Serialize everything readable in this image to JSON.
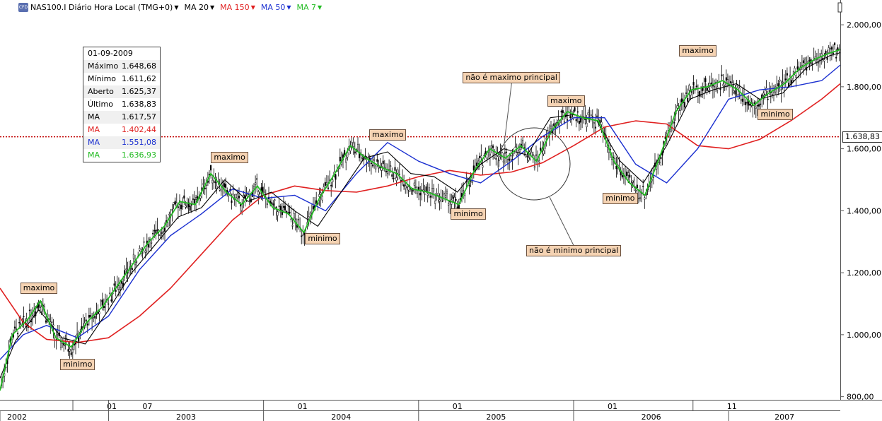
{
  "header": {
    "logo_text": "CFD",
    "symbol": "NAS100.I Diário Hora Local (TMG+0)",
    "indicators": [
      {
        "label": "MA 20",
        "color": "#000000"
      },
      {
        "label": "MA 150",
        "color": "#e02020"
      },
      {
        "label": "MA 50",
        "color": "#1a2fd0"
      },
      {
        "label": "MA 7",
        "color": "#22bb22"
      }
    ]
  },
  "infobox": {
    "date": "01-09-2009",
    "rows": [
      {
        "label": "Máximo",
        "value": "1.648,68",
        "color": "#000000"
      },
      {
        "label": "Mínimo",
        "value": "1.611,62",
        "color": "#000000"
      },
      {
        "label": "Aberto",
        "value": "1.625,37",
        "color": "#000000"
      },
      {
        "label": "Último",
        "value": "1.638,83",
        "color": "#000000"
      },
      {
        "label": "MA",
        "value": "1.617,57",
        "color": "#000000"
      },
      {
        "label": "MA",
        "value": "1.402,44",
        "color": "#e02020"
      },
      {
        "label": "MA",
        "value": "1.551,08",
        "color": "#1a2fd0"
      },
      {
        "label": "MA",
        "value": "1.636,93",
        "color": "#22bb22"
      }
    ]
  },
  "current_price_label": "1.638,83",
  "annotations": [
    {
      "text": "maximo",
      "x": 2002.55,
      "y": 1150,
      "kind": "max"
    },
    {
      "text": "minimo",
      "x": 2002.8,
      "y": 905,
      "kind": "min"
    },
    {
      "text": "maximo",
      "x": 2003.78,
      "y": 1572,
      "kind": "max"
    },
    {
      "text": "minimo",
      "x": 2004.38,
      "y": 1310,
      "kind": "min"
    },
    {
      "text": "maximo",
      "x": 2004.8,
      "y": 1645,
      "kind": "max"
    },
    {
      "text": "minimo",
      "x": 2005.32,
      "y": 1390,
      "kind": "min"
    },
    {
      "text": "maximo",
      "x": 2005.95,
      "y": 1755,
      "kind": "max"
    },
    {
      "text": "minimo",
      "x": 2006.3,
      "y": 1440,
      "kind": "min"
    },
    {
      "text": "maximo",
      "x": 2006.8,
      "y": 1915,
      "kind": "max"
    },
    {
      "text": "minimo",
      "x": 2007.3,
      "y": 1710,
      "kind": "min"
    },
    {
      "text": "não é maximo principal",
      "x": 2005.6,
      "y": 1830,
      "kind": "note"
    },
    {
      "text": "não é minimo principal",
      "x": 2006.0,
      "y": 1270,
      "kind": "note"
    }
  ],
  "chart_data": {
    "type": "line",
    "title": "NAS100.I Diário Hora Local (TMG+0)",
    "xlabel": "",
    "ylabel": "",
    "xlim": [
      2002.3,
      2007.72
    ],
    "ylim": [
      790,
      2080
    ],
    "grid": false,
    "legend": "top-left",
    "current_price": 1638.83,
    "y_ticks": [
      {
        "value": 800,
        "label": "800,00"
      },
      {
        "value": 1000,
        "label": "1.000,00"
      },
      {
        "value": 1200,
        "label": "1.200,00"
      },
      {
        "value": 1400,
        "label": "1.400,00"
      },
      {
        "value": 1600,
        "label": "1.600,00"
      },
      {
        "value": 1800,
        "label": "1.800,00"
      },
      {
        "value": 2000,
        "label": "2.000,00"
      }
    ],
    "x_ticks_upper": [
      {
        "x": 2002.77,
        "label": "01"
      },
      {
        "x": 2003.0,
        "label": "07"
      },
      {
        "x": 2004.0,
        "label": "01"
      },
      {
        "x": 2005.0,
        "label": "01"
      },
      {
        "x": 2006.0,
        "label": "01"
      },
      {
        "x": 2006.77,
        "label": "11"
      }
    ],
    "x_ticks_lower": [
      {
        "x": 2002.3,
        "label": "2002"
      },
      {
        "x": 2003.0,
        "label": "2003"
      },
      {
        "x": 2004.0,
        "label": "2004"
      },
      {
        "x": 2005.0,
        "label": "2005"
      },
      {
        "x": 2006.0,
        "label": "2006"
      },
      {
        "x": 2007.0,
        "label": "2007"
      }
    ],
    "series": [
      {
        "name": "MA 150",
        "color": "#e02020",
        "x": [
          2002.3,
          2002.45,
          2002.6,
          2002.8,
          2003.0,
          2003.2,
          2003.4,
          2003.6,
          2003.8,
          2004.0,
          2004.2,
          2004.4,
          2004.6,
          2004.8,
          2005.0,
          2005.2,
          2005.4,
          2005.6,
          2005.8,
          2006.0,
          2006.2,
          2006.4,
          2006.6,
          2006.8,
          2007.0,
          2007.2,
          2007.4,
          2007.6,
          2007.72
        ],
        "values": [
          1150,
          1040,
          985,
          975,
          990,
          1060,
          1150,
          1260,
          1370,
          1450,
          1480,
          1465,
          1460,
          1480,
          1510,
          1530,
          1515,
          1525,
          1555,
          1610,
          1670,
          1690,
          1680,
          1610,
          1600,
          1630,
          1690,
          1760,
          1810
        ]
      },
      {
        "name": "MA 50",
        "color": "#1a2fd0",
        "x": [
          2002.3,
          2002.45,
          2002.6,
          2002.8,
          2003.0,
          2003.2,
          2003.4,
          2003.6,
          2003.8,
          2004.0,
          2004.2,
          2004.4,
          2004.6,
          2004.8,
          2005.0,
          2005.2,
          2005.4,
          2005.6,
          2005.8,
          2006.0,
          2006.2,
          2006.4,
          2006.6,
          2006.8,
          2007.0,
          2007.2,
          2007.4,
          2007.6,
          2007.72
        ],
        "values": [
          920,
          1000,
          1030,
          990,
          1060,
          1210,
          1320,
          1390,
          1470,
          1440,
          1450,
          1400,
          1520,
          1620,
          1560,
          1520,
          1490,
          1560,
          1640,
          1700,
          1700,
          1550,
          1490,
          1600,
          1760,
          1790,
          1800,
          1820,
          1870
        ]
      },
      {
        "name": "MA 20",
        "color": "#000000",
        "x": [
          2002.3,
          2002.4,
          2002.55,
          2002.7,
          2002.85,
          2003.0,
          2003.15,
          2003.3,
          2003.45,
          2003.6,
          2003.75,
          2003.9,
          2004.05,
          2004.2,
          2004.35,
          2004.5,
          2004.65,
          2004.8,
          2004.95,
          2005.1,
          2005.25,
          2005.4,
          2005.55,
          2005.7,
          2005.85,
          2006.0,
          2006.15,
          2006.3,
          2006.45,
          2006.6,
          2006.75,
          2006.9,
          2007.05,
          2007.2,
          2007.35,
          2007.5,
          2007.65,
          2007.72
        ],
        "values": [
          860,
          980,
          1080,
          990,
          970,
          1080,
          1200,
          1290,
          1380,
          1410,
          1500,
          1430,
          1460,
          1400,
          1350,
          1460,
          1570,
          1590,
          1520,
          1510,
          1460,
          1550,
          1600,
          1580,
          1700,
          1710,
          1690,
          1560,
          1490,
          1610,
          1760,
          1790,
          1810,
          1760,
          1780,
          1860,
          1900,
          1910
        ]
      },
      {
        "name": "MA 7",
        "color": "#22bb22",
        "x": [
          2002.3,
          2002.38,
          2002.48,
          2002.56,
          2002.66,
          2002.76,
          2002.86,
          2002.96,
          2003.06,
          2003.16,
          2003.26,
          2003.36,
          2003.46,
          2003.56,
          2003.66,
          2003.76,
          2003.86,
          2003.96,
          2004.06,
          2004.16,
          2004.26,
          2004.36,
          2004.46,
          2004.56,
          2004.66,
          2004.76,
          2004.86,
          2004.96,
          2005.06,
          2005.16,
          2005.26,
          2005.36,
          2005.46,
          2005.56,
          2005.66,
          2005.76,
          2005.86,
          2005.96,
          2006.06,
          2006.16,
          2006.26,
          2006.36,
          2006.46,
          2006.56,
          2006.66,
          2006.76,
          2006.86,
          2006.96,
          2007.06,
          2007.16,
          2007.26,
          2007.36,
          2007.46,
          2007.56,
          2007.66,
          2007.72
        ],
        "values": [
          820,
          1000,
          1050,
          1110,
          990,
          960,
          1040,
          1090,
          1160,
          1230,
          1300,
          1350,
          1430,
          1420,
          1520,
          1460,
          1420,
          1480,
          1410,
          1390,
          1330,
          1440,
          1520,
          1610,
          1570,
          1540,
          1520,
          1470,
          1460,
          1440,
          1420,
          1530,
          1600,
          1570,
          1610,
          1560,
          1660,
          1720,
          1700,
          1690,
          1560,
          1490,
          1450,
          1580,
          1720,
          1790,
          1800,
          1820,
          1790,
          1740,
          1780,
          1810,
          1860,
          1890,
          1910,
          1920
        ]
      }
    ]
  }
}
